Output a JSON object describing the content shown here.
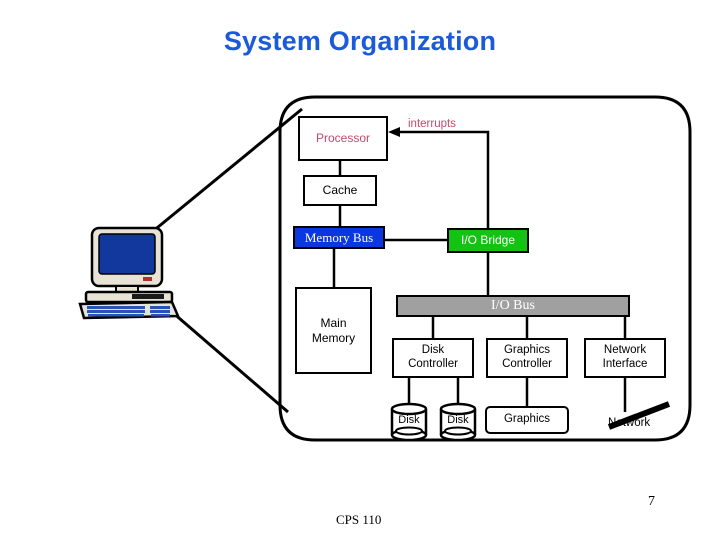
{
  "slide": {
    "title": "System Organization",
    "page_number": "7",
    "course": "CPS 110"
  },
  "colors": {
    "title": "#1b5bd7",
    "processor_text": "#c24a6b",
    "interrupts_text": "#c24a6b",
    "memory_bus_fill": "#0a37e0",
    "io_bridge_fill": "#13c313",
    "io_bus_fill": "#a0a0a0",
    "monitor_screen": "#12389e",
    "case_body": "#e8e3d4",
    "outline": "#000000"
  },
  "diagram": {
    "callout_shape": "rounded-rectangle-with-tail",
    "boxes": {
      "processor": "Processor",
      "cache": "Cache",
      "memory_bus": "Memory Bus",
      "io_bridge": "I/O Bridge",
      "io_bus": "I/O Bus",
      "main_memory": "Main\nMemory",
      "main_memory_line1": "Main",
      "main_memory_line2": "Memory",
      "disk_controller_line1": "Disk",
      "disk_controller_line2": "Controller",
      "graphics_controller_line1": "Graphics",
      "graphics_controller_line2": "Controller",
      "network_interface_line1": "Network",
      "network_interface_line2": "Interface",
      "graphics": "Graphics"
    },
    "devices": {
      "disk_1": "Disk",
      "disk_2": "Disk",
      "network": "Network"
    },
    "labels": {
      "interrupts": "interrupts"
    },
    "clipart": {
      "computer": "desktop-computer"
    }
  }
}
